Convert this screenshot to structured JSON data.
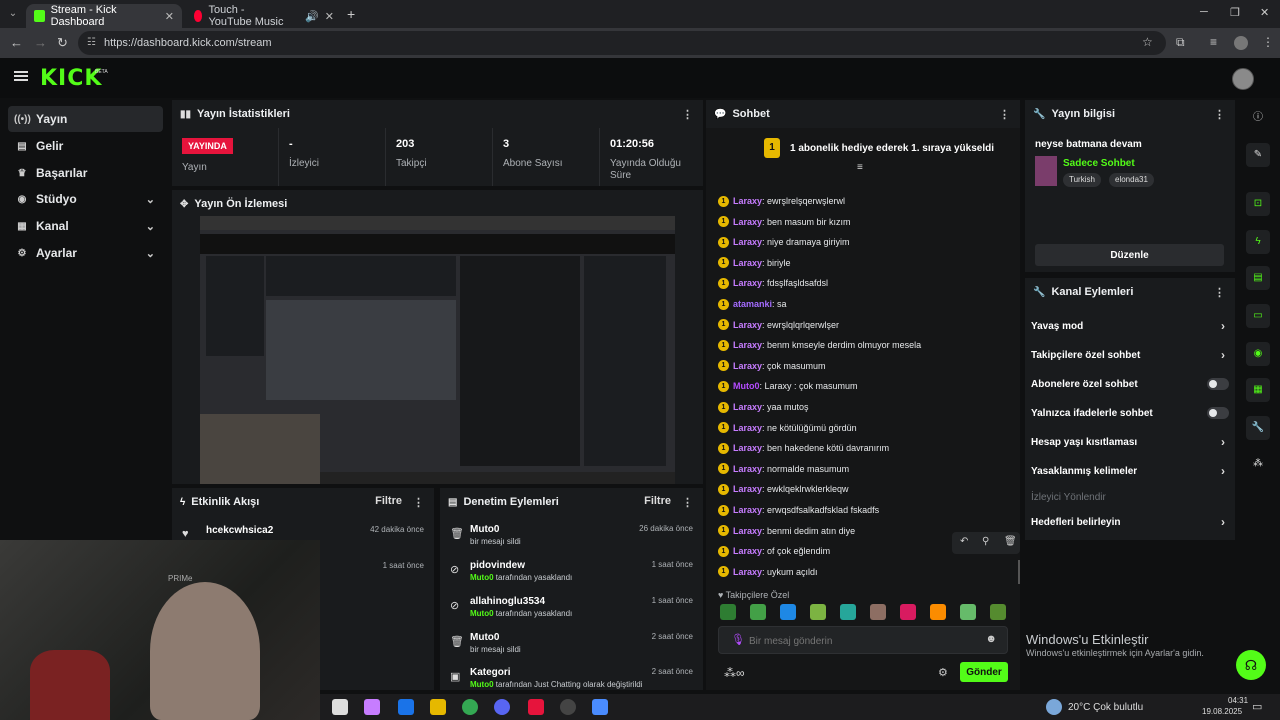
{
  "browser": {
    "tabs": [
      {
        "title": "Stream - Kick Dashboard",
        "close": "✕",
        "favicon_color": "#53fc18"
      },
      {
        "title": "Touch - YouTube Music",
        "close": "✕",
        "favicon_color": "#ff0033"
      }
    ],
    "new_tab": "+",
    "url": "https://dashboard.kick.com/stream"
  },
  "header": {
    "logo": "KICK",
    "beta": "BETA"
  },
  "sidebar": {
    "items": [
      {
        "label": "Yayın",
        "icon": "broadcast-icon",
        "glyph": "((•))"
      },
      {
        "label": "Gelir",
        "icon": "revenue-icon",
        "glyph": "▤"
      },
      {
        "label": "Başarılar",
        "icon": "trophy-icon",
        "glyph": "🏆"
      },
      {
        "label": "Stüdyo",
        "icon": "studio-icon",
        "glyph": "◉"
      },
      {
        "label": "Kanal",
        "icon": "channel-icon",
        "glyph": "▦"
      },
      {
        "label": "Ayarlar",
        "icon": "gear-icon",
        "glyph": "⚙"
      }
    ]
  },
  "stats": {
    "title": "Yayın İstatistikleri",
    "live_badge": "YAYINDA",
    "live_label": "Yayın",
    "viewers_value": "-",
    "viewers_label": "İzleyici",
    "followers_value": "203",
    "followers_label": "Takipçi",
    "subs_value": "3",
    "subs_label": "Abone Sayısı",
    "duration_value": "01:20:56",
    "duration_label": "Yayında Olduğu Süre"
  },
  "preview": {
    "title": "Yayın Ön İzlemesi"
  },
  "activity": {
    "title": "Etkinlik Akışı",
    "filter": "Filtre",
    "items": [
      {
        "user": "hcekcwhsica2",
        "time": "42 dakika önce"
      },
      {
        "user": "",
        "time": "1 saat önce"
      }
    ]
  },
  "moderation": {
    "title": "Denetim Eylemleri",
    "filter": "Filtre",
    "items": [
      {
        "title": "Muto0",
        "by": "",
        "desc": "bir mesajı sildi",
        "time": "26 dakika önce"
      },
      {
        "title": "pidovindew",
        "by": "Muto0",
        "desc": " tarafından yasaklandı",
        "time": "1 saat önce"
      },
      {
        "title": "allahinoglu3534",
        "by": "Muto0",
        "desc": " tarafından yasaklandı",
        "time": "1 saat önce"
      },
      {
        "title": "Muto0",
        "by": "",
        "desc": "bir mesajı sildi",
        "time": "2 saat önce"
      },
      {
        "title": "Kategori",
        "by": "Muto0",
        "desc": " tarafından Just Chatting olarak değiştirildi",
        "time": "2 saat önce"
      }
    ]
  },
  "chat": {
    "title": "Sohbet",
    "pinned_count": "1",
    "pinned_text": "1 abonelik hediye ederek 1. sıraya yükseldi",
    "messages": [
      {
        "user": "Laraxy",
        "text": ": ewrşlrelşqerwşlerwl",
        "color": "#c77dff"
      },
      {
        "user": "Laraxy",
        "text": ": ben masum bir kızım",
        "color": "#c77dff"
      },
      {
        "user": "Laraxy",
        "text": ": niye dramaya giriyim",
        "color": "#c77dff"
      },
      {
        "user": "Laraxy",
        "text": ": biriyle",
        "color": "#c77dff"
      },
      {
        "user": "Laraxy",
        "text": ": fdsşlfaşldsafdsl",
        "color": "#c77dff"
      },
      {
        "user": "atamanki",
        "text": ": sa",
        "color": "#a36bff"
      },
      {
        "user": "Laraxy",
        "text": ": ewrşlqlqrlqerwlşer",
        "color": "#c77dff"
      },
      {
        "user": "Laraxy",
        "text": ": benm kmseyle derdim olmuyor mesela",
        "color": "#c77dff"
      },
      {
        "user": "Laraxy",
        "text": ": çok masumum",
        "color": "#c77dff"
      },
      {
        "user": "Muto0",
        "text": ": Laraxy : çok masumum",
        "color": "#b44cff"
      },
      {
        "user": "Laraxy",
        "text": ": yaa mutoş",
        "color": "#c77dff"
      },
      {
        "user": "Laraxy",
        "text": ": ne kötülüğümü gördün",
        "color": "#c77dff"
      },
      {
        "user": "Laraxy",
        "text": ": ben hakedene kötü davranırım",
        "color": "#c77dff"
      },
      {
        "user": "Laraxy",
        "text": ": normalde masumum",
        "color": "#c77dff"
      },
      {
        "user": "Laraxy",
        "text": ": ewklqeklrwklerkleqw",
        "color": "#c77dff"
      },
      {
        "user": "Laraxy",
        "text": ": erwqsdfsalkadfsklad fskadfs",
        "color": "#c77dff"
      },
      {
        "user": "Laraxy",
        "text": ": benmi dedim atın diye",
        "color": "#c77dff"
      },
      {
        "user": "Laraxy",
        "text": ": of çok eğlendim",
        "color": "#c77dff"
      },
      {
        "user": "Laraxy",
        "text": ": uykum açıldı",
        "color": "#c77dff"
      }
    ],
    "emotes_label": "♥ Takipçilere Özel",
    "input_placeholder": "Bir mesaj gönderin",
    "send": "Gönder"
  },
  "stream_info": {
    "title": "Yayın bilgisi",
    "stream_title": "neyse batmana devam",
    "category": "Sadece Sohbet",
    "tags": [
      "Turkish",
      "elonda31"
    ],
    "edit": "Düzenle"
  },
  "channel_actions": {
    "title": "Kanal Eylemleri",
    "items": [
      {
        "label": "Yavaş mod",
        "kind": "chevron"
      },
      {
        "label": "Takipçilere özel sohbet",
        "kind": "chevron"
      },
      {
        "label": "Abonelere özel sohbet",
        "kind": "toggle"
      },
      {
        "label": "Yalnızca ifadelerle sohbet",
        "kind": "toggle"
      },
      {
        "label": "Hesap yaşı kısıtlaması",
        "kind": "chevron"
      },
      {
        "label": "Yasaklanmış kelimeler",
        "kind": "chevron"
      },
      {
        "label": "İzleyici Yönlendir",
        "kind": "disabled"
      },
      {
        "label": "Hedefleri belirleyin",
        "kind": "chevron"
      }
    ]
  },
  "windows": {
    "activate_title": "Windows'u Etkinleştir",
    "activate_sub": "Windows'u etkinleştirmek için Ayarlar'a gidin."
  },
  "taskbar": {
    "weather": "20°C  Çok bulutlu",
    "time": "04:31",
    "date": "19.08.2025"
  },
  "webcam": {
    "overlay": "PRIMe"
  }
}
